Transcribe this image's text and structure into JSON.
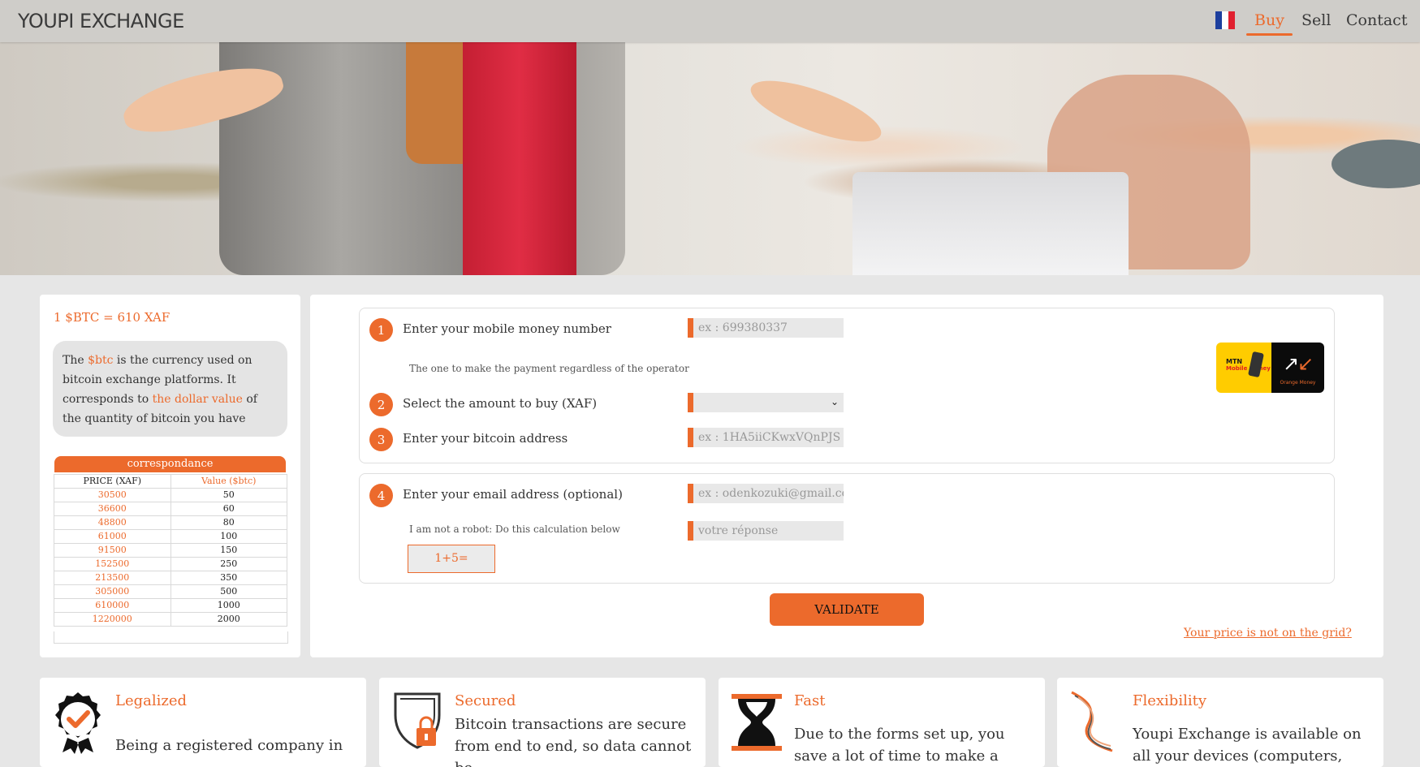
{
  "nav": {
    "logo": "YOUPI EXCHANGE",
    "links": [
      "Buy",
      "Sell",
      "Contact"
    ],
    "active": "Buy",
    "language_icon": "france-flag-icon"
  },
  "sidebar": {
    "rate": "1 $BTC = 610 XAF",
    "info_parts": [
      "The ",
      "$btc",
      " is the currency used on bitcoin exchange platforms. It corresponds to ",
      "the dollar value",
      " of the quantity of bitcoin you have"
    ],
    "table_title": "correspondance",
    "table_headers": [
      "PRICE (XAF)",
      "Value ($btc)"
    ],
    "rows": [
      [
        "30500",
        "50"
      ],
      [
        "36600",
        "60"
      ],
      [
        "48800",
        "80"
      ],
      [
        "61000",
        "100"
      ],
      [
        "91500",
        "150"
      ],
      [
        "152500",
        "250"
      ],
      [
        "213500",
        "350"
      ],
      [
        "305000",
        "500"
      ],
      [
        "610000",
        "1000"
      ],
      [
        "1220000",
        "2000"
      ]
    ]
  },
  "form": {
    "steps": [
      {
        "number": "1",
        "label": "Enter your mobile money number",
        "placeholder": "ex : 699380337"
      },
      {
        "number": "2",
        "label": "Select the amount to buy (XAF)",
        "placeholder": ""
      },
      {
        "number": "3",
        "label": "Enter your bitcoin address",
        "placeholder": "ex : 1HA5iiCKwxVQnPJS"
      },
      {
        "number": "4",
        "label": "Enter your email address (optional)",
        "placeholder": "ex : odenkozuki@gmail.cc"
      }
    ],
    "operator_hint": "The one to make the payment regardless of the operator",
    "robot_hint": "I am not a robot: Do this calculation below",
    "captcha_placeholder": "votre réponse",
    "captcha_question": "1+5=",
    "validate_label": "VALIDATE",
    "price_link": "Your price is not on the grid?",
    "payment_logos": {
      "mtn": "MTN",
      "mtn_sub": "Mobile Money",
      "orange": "Orange Money"
    }
  },
  "features": [
    {
      "title": "Legalized",
      "text": "Being a registered company in",
      "icon": "certified-badge-icon"
    },
    {
      "title": "Secured",
      "text": "Bitcoin transactions are secure from end to end, so data cannot be",
      "icon": "shield-lock-icon"
    },
    {
      "title": "Fast",
      "text": "Due to the forms set up, you save a lot of time to make a transaction",
      "icon": "hourglass-icon"
    },
    {
      "title": "Flexibility",
      "text": "Youpi Exchange is available on all your devices (computers, phones",
      "icon": "flexible-ribbon-icon"
    }
  ],
  "colors": {
    "accent": "#ec6a2c",
    "nav_bg": "#cfcdc9",
    "page_bg": "#e6e6e6"
  }
}
